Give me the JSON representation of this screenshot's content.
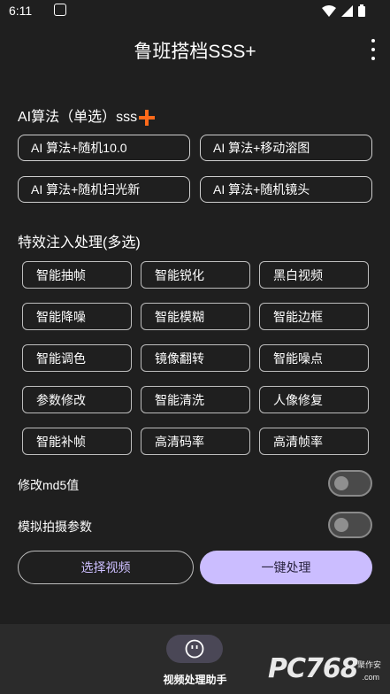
{
  "status": {
    "time": "6:11"
  },
  "app": {
    "title": "鲁班搭档SSS+"
  },
  "ai_section": {
    "title": "AI算法（单选）sss"
  },
  "ai_options": [
    "AI 算法+随机10.0",
    "AI 算法+移动溶图",
    "AI 算法+随机扫光新",
    "AI 算法+随机镜头"
  ],
  "effects_section": {
    "title": "特效注入处理(多选)"
  },
  "effects": [
    "智能抽帧",
    "智能锐化",
    "黑白视频",
    "智能降噪",
    "智能模糊",
    "智能边框",
    "智能调色",
    "镜像翻转",
    "智能噪点",
    "参数修改",
    "智能清洗",
    "人像修复",
    "智能补帧",
    "高清码率",
    "高清帧率"
  ],
  "toggles": {
    "md5": {
      "label": "修改md5值",
      "on": false
    },
    "shoot": {
      "label": "模拟拍摄参数",
      "on": false
    }
  },
  "actions": {
    "select_video": "选择视频",
    "one_click": "一键处理"
  },
  "bottom_nav": {
    "label": "视频处理助手",
    "icon": "smile-icon"
  },
  "watermark": {
    "text": "PC768",
    "small": "聚作安",
    "com": ".com"
  },
  "colors": {
    "accent_plus": "#ff6a1a",
    "primary": "#cbbdff",
    "background": "#1f1f1f"
  }
}
